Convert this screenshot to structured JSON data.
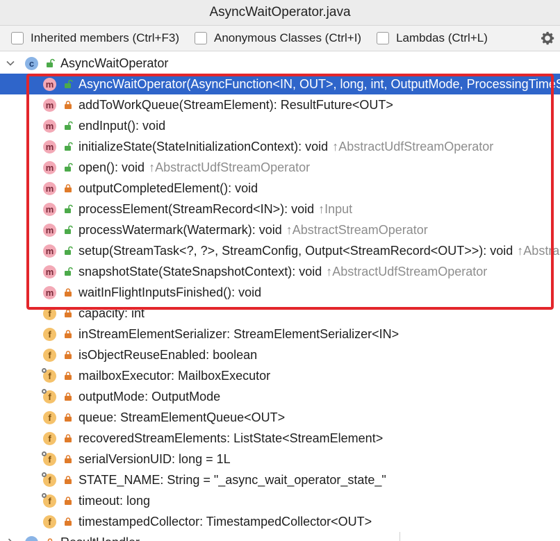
{
  "window": {
    "title": "AsyncWaitOperator.java"
  },
  "options": [
    {
      "label": "Inherited members (Ctrl+F3)",
      "checked": false
    },
    {
      "label": "Anonymous Classes (Ctrl+I)",
      "checked": false
    },
    {
      "label": "Lambdas (Ctrl+L)",
      "checked": false
    }
  ],
  "colors": {
    "selection": "#2f65ca",
    "highlight_border": "#e3262b",
    "method_badge": "#f3a9b6",
    "field_badge": "#f5c26b",
    "class_badge": "#8ab4e6",
    "public_icon": "#4caa4a",
    "private_icon": "#e07b2a"
  },
  "tree": {
    "class_name": "AsyncWaitOperator",
    "class_badge": "c",
    "methods": [
      {
        "name": "AsyncWaitOperator(AsyncFunction<IN, OUT>, long, int, OutputMode, ProcessingTimeService, MailboxExecutor)",
        "inherited": "",
        "visibility": "public",
        "selected": true
      },
      {
        "name": "addToWorkQueue(StreamElement): ResultFuture<OUT>",
        "inherited": "",
        "visibility": "private",
        "selected": false
      },
      {
        "name": "endInput(): void",
        "inherited": "",
        "visibility": "public",
        "selected": false
      },
      {
        "name": "initializeState(StateInitializationContext): void",
        "inherited": "↑AbstractUdfStreamOperator",
        "visibility": "public",
        "selected": false
      },
      {
        "name": "open(): void",
        "inherited": "↑AbstractUdfStreamOperator",
        "visibility": "public",
        "selected": false
      },
      {
        "name": "outputCompletedElement(): void",
        "inherited": "",
        "visibility": "private",
        "selected": false
      },
      {
        "name": "processElement(StreamRecord<IN>): void",
        "inherited": "↑Input",
        "visibility": "public",
        "selected": false
      },
      {
        "name": "processWatermark(Watermark): void",
        "inherited": "↑AbstractStreamOperator",
        "visibility": "public",
        "selected": false
      },
      {
        "name": "setup(StreamTask<?, ?>, StreamConfig, Output<StreamRecord<OUT>>): void",
        "inherited": "↑AbstractUdfStreamOperator",
        "visibility": "public",
        "selected": false
      },
      {
        "name": "snapshotState(StateSnapshotContext): void",
        "inherited": "↑AbstractUdfStreamOperator",
        "visibility": "public",
        "selected": false
      },
      {
        "name": "waitInFlightInputsFinished(): void",
        "inherited": "",
        "visibility": "private",
        "selected": false
      }
    ],
    "fields": [
      {
        "name": "capacity: int",
        "pinned": false
      },
      {
        "name": "inStreamElementSerializer: StreamElementSerializer<IN>",
        "pinned": false
      },
      {
        "name": "isObjectReuseEnabled: boolean",
        "pinned": false
      },
      {
        "name": "mailboxExecutor: MailboxExecutor",
        "pinned": true
      },
      {
        "name": "outputMode: OutputMode",
        "pinned": true
      },
      {
        "name": "queue: StreamElementQueue<OUT>",
        "pinned": false
      },
      {
        "name": "recoveredStreamElements: ListState<StreamElement>",
        "pinned": false
      },
      {
        "name": "serialVersionUID: long = 1L",
        "pinned": true
      },
      {
        "name": "STATE_NAME: String = \"_async_wait_operator_state_\"",
        "pinned": true
      },
      {
        "name": "timeout: long",
        "pinned": true
      },
      {
        "name": "timestampedCollector: TimestampedCollector<OUT>",
        "pinned": false
      }
    ],
    "next_class": "ResultHandler"
  }
}
